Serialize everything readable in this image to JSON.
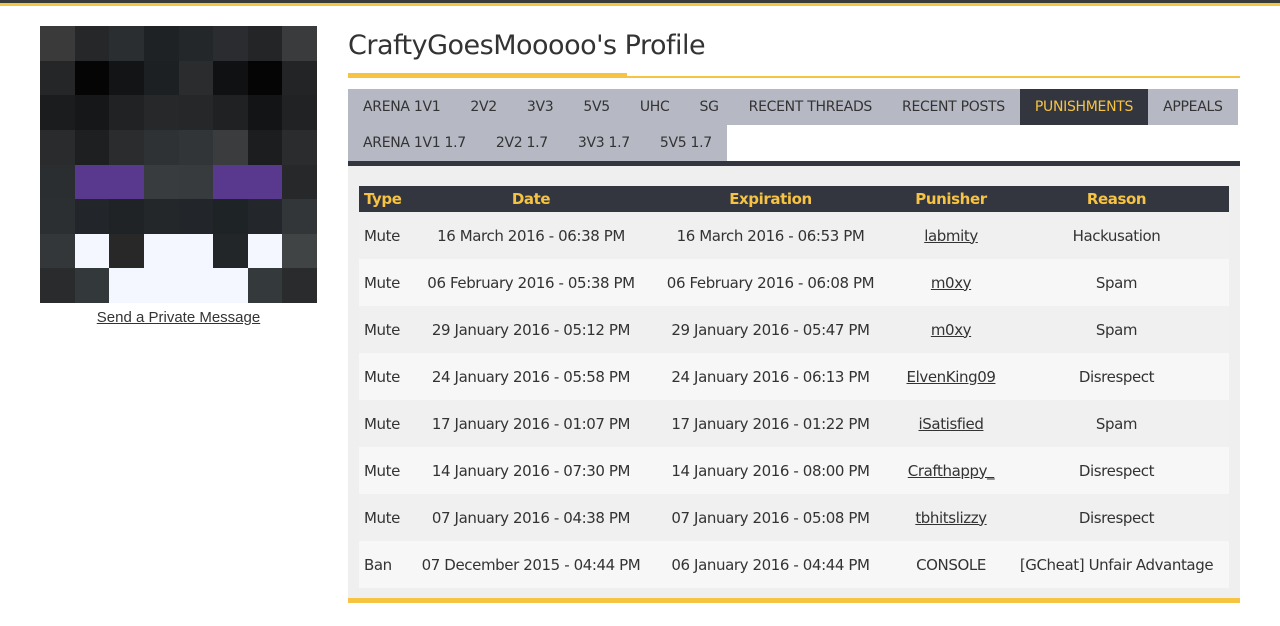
{
  "profile": {
    "title": "CraftyGoesMooooo's Profile",
    "send_message_label": "Send a Private Message"
  },
  "tabs": {
    "row1": [
      "ARENA 1V1",
      "2V2",
      "3V3",
      "5V5",
      "UHC",
      "SG",
      "RECENT THREADS",
      "RECENT POSTS",
      "PUNISHMENTS",
      "APPEALS"
    ],
    "row2": [
      "ARENA 1V1 1.7",
      "2V2 1.7",
      "3V3 1.7",
      "5V5 1.7"
    ],
    "active": "PUNISHMENTS"
  },
  "table": {
    "headers": [
      "Type",
      "Date",
      "Expiration",
      "Punisher",
      "Reason"
    ],
    "rows": [
      {
        "type": "Mute",
        "date": "16 March 2016 - 06:38 PM",
        "expiration": "16 March 2016 - 06:53 PM",
        "punisher": "labmity",
        "punisher_link": true,
        "reason": "Hackusation"
      },
      {
        "type": "Mute",
        "date": "06 February 2016 - 05:38 PM",
        "expiration": "06 February 2016 - 06:08 PM",
        "punisher": "m0xy",
        "punisher_link": true,
        "reason": "Spam"
      },
      {
        "type": "Mute",
        "date": "29 January 2016 - 05:12 PM",
        "expiration": "29 January 2016 - 05:47 PM",
        "punisher": "m0xy",
        "punisher_link": true,
        "reason": "Spam"
      },
      {
        "type": "Mute",
        "date": "24 January 2016 - 05:58 PM",
        "expiration": "24 January 2016 - 06:13 PM",
        "punisher": "ElvenKing09",
        "punisher_link": true,
        "reason": "Disrespect"
      },
      {
        "type": "Mute",
        "date": "17 January 2016 - 01:07 PM",
        "expiration": "17 January 2016 - 01:22 PM",
        "punisher": "iSatisfied",
        "punisher_link": true,
        "reason": "Spam"
      },
      {
        "type": "Mute",
        "date": "14 January 2016 - 07:30 PM",
        "expiration": "14 January 2016 - 08:00 PM",
        "punisher": "Crafthappy_",
        "punisher_link": true,
        "reason": "Disrespect"
      },
      {
        "type": "Mute",
        "date": "07 January 2016 - 04:38 PM",
        "expiration": "07 January 2016 - 05:08 PM",
        "punisher": "tbhitslizzy",
        "punisher_link": true,
        "reason": "Disrespect"
      },
      {
        "type": "Ban",
        "date": "07 December 2015 - 04:44 PM",
        "expiration": "06 January 2016 - 04:44 PM",
        "punisher": "CONSOLE",
        "punisher_link": false,
        "reason": "[GCheat] Unfair Advantage"
      }
    ]
  },
  "colors": {
    "accent": "#f6c343",
    "dark": "#33363f",
    "tab_bg": "#b6b9c4",
    "panel_bg": "#efefef"
  },
  "avatar_pixels": [
    [
      "#3a3a3a",
      "#262728",
      "#2b2e30",
      "#1f2224",
      "#24272a",
      "#2a2c2f",
      "#232527",
      "#3a3b3c"
    ],
    [
      "#252628",
      "#050505",
      "#131415",
      "#1d2022",
      "#2a2c2e",
      "#101112",
      "#050505",
      "#232426"
    ],
    [
      "#1b1c1d",
      "#161718",
      "#202224",
      "#26282a",
      "#252729",
      "#1f2123",
      "#131415",
      "#202223"
    ],
    [
      "#2a2b2d",
      "#1d1f21",
      "#2a2c2e",
      "#2f3234",
      "#323537",
      "#3a3c3e",
      "#1b1d1f",
      "#2a2c2e"
    ],
    [
      "#2a2e30",
      "#59398e",
      "#59398e",
      "#383c3e",
      "#383b3d",
      "#59398e",
      "#59398e",
      "#262829"
    ],
    [
      "#2c2f31",
      "#22262a",
      "#1f2326",
      "#23272a",
      "#22262a",
      "#1e2326",
      "#23272b",
      "#333638"
    ],
    [
      "#333739",
      "#f4f7ff",
      "#282828",
      "#f4f7ff",
      "#f4f7ff",
      "#232628",
      "#f4f7ff",
      "#404445"
    ],
    [
      "#2a2b2d",
      "#33383a",
      "#f4f7ff",
      "#f4f7ff",
      "#f4f7ff",
      "#f4f7ff",
      "#343a3c",
      "#2a2b2d"
    ]
  ]
}
